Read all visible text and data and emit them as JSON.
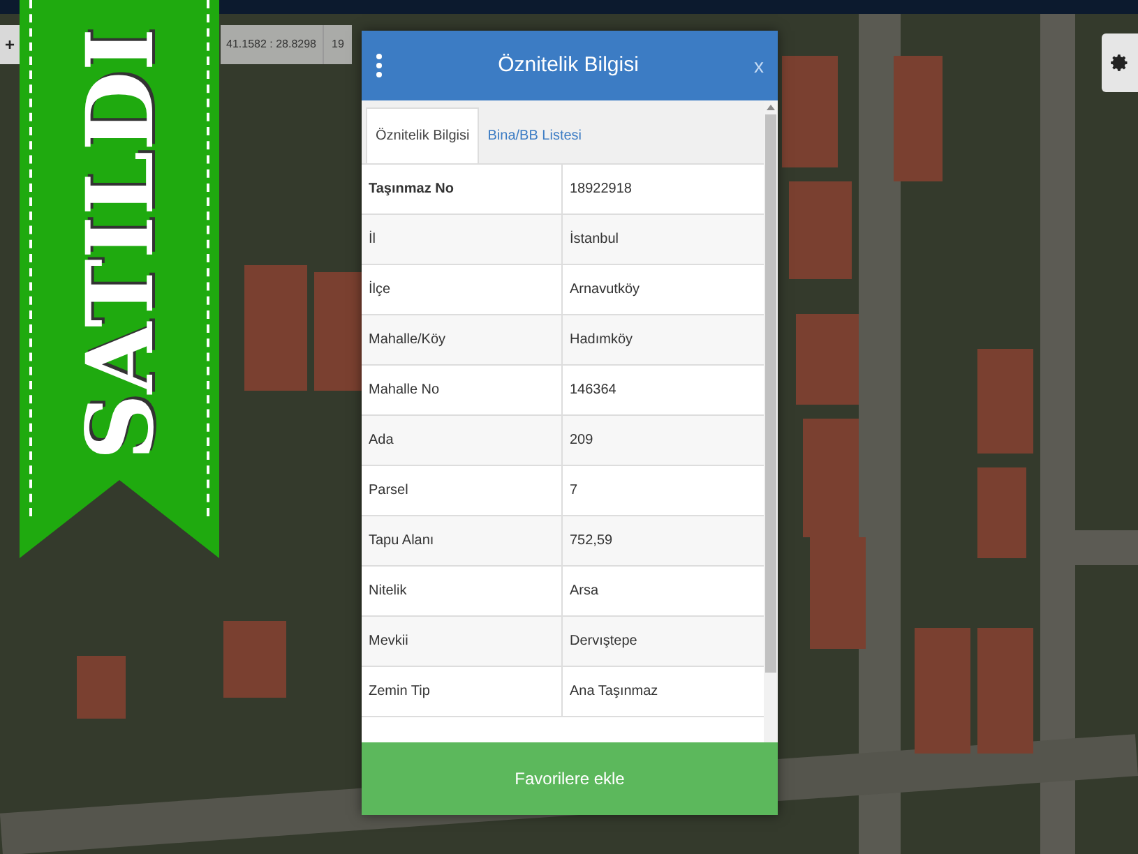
{
  "map_toolbar": {
    "zoom_in": "+",
    "coordinates": "41.1582 : 28.8298",
    "zoom_level": "19"
  },
  "sold_ribbon": {
    "text": "SATILDI"
  },
  "panel": {
    "title": "Öznitelik Bilgisi",
    "close": "x",
    "tabs": [
      {
        "label": "Öznitelik Bilgisi",
        "selected": true
      },
      {
        "label": "Bina/BB Listesi",
        "selected": false
      }
    ],
    "rows": [
      {
        "label": "Taşınmaz No",
        "value": "18922918",
        "bold": true
      },
      {
        "label": "İl",
        "value": "İstanbul",
        "bold": false
      },
      {
        "label": "İlçe",
        "value": "Arnavutköy",
        "bold": false
      },
      {
        "label": "Mahalle/Köy",
        "value": "Hadımköy",
        "bold": false
      },
      {
        "label": "Mahalle No",
        "value": "146364",
        "bold": false
      },
      {
        "label": "Ada",
        "value": "209",
        "bold": false
      },
      {
        "label": "Parsel",
        "value": "7",
        "bold": false
      },
      {
        "label": "Tapu Alanı",
        "value": "752,59",
        "bold": false
      },
      {
        "label": "Nitelik",
        "value": "Arsa",
        "bold": false
      },
      {
        "label": "Mevkii",
        "value": "Dervıştepe",
        "bold": false
      },
      {
        "label": "Zemin Tip",
        "value": "Ana Taşınmaz",
        "bold": false
      }
    ],
    "button": "Favorilere ekle"
  }
}
